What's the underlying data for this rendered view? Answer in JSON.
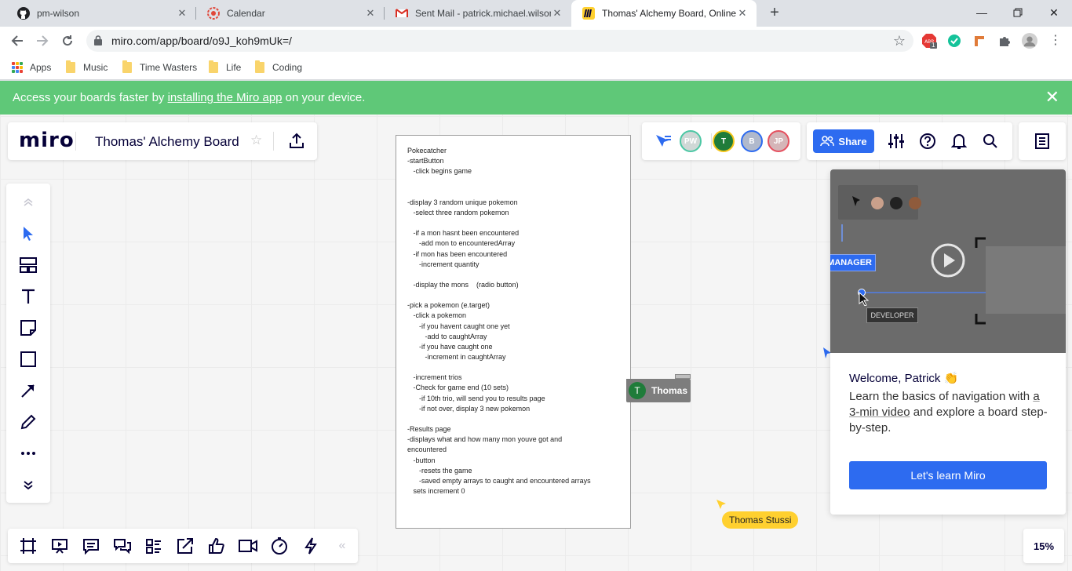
{
  "browser": {
    "tabs": [
      {
        "title": "pm-wilson",
        "icon": "github-icon"
      },
      {
        "title": "Calendar",
        "icon": "calendar-icon"
      },
      {
        "title": "Sent Mail - patrick.michael.wilson",
        "icon": "gmail-icon"
      },
      {
        "title": "Thomas' Alchemy Board, Online",
        "icon": "miro-icon"
      }
    ],
    "url": "miro.com/app/board/o9J_koh9mUk=/",
    "ext_badge": "1",
    "bookmarks": [
      {
        "label": "Apps"
      },
      {
        "label": "Music"
      },
      {
        "label": "Time Wasters"
      },
      {
        "label": "Life"
      },
      {
        "label": "Coding"
      }
    ]
  },
  "banner": {
    "prefix": "Access your boards faster by ",
    "link": "installing the Miro app",
    "suffix": " on your device."
  },
  "miro": {
    "logo": "miro",
    "board_name": "Thomas' Alchemy Board",
    "collaborators": [
      {
        "initials": "PW",
        "color": "#4cc7a4"
      },
      {
        "initials": "T",
        "color": "#1f7c3a"
      },
      {
        "initials": "B",
        "color": "#8ea4cf"
      },
      {
        "initials": "JP",
        "color": "#e58e96"
      }
    ],
    "share_label": "Share",
    "zoom": "15%",
    "collapse_label": "«"
  },
  "document": {
    "lines": [
      "Pokecatcher",
      "-startButton",
      "   -click begins game",
      "",
      "",
      "-display 3 random unique pokemon",
      "   -select three random pokemon",
      "",
      "   -if a mon hasnt been encountered",
      "      -add mon to encounteredArray",
      "   -if mon has been encountered",
      "      -increment quantity",
      "",
      "   -display the mons    (radio button)",
      "",
      "-pick a pokemon (e.target)",
      "   -click a pokemon",
      "      -if you havent caught one yet",
      "         -add to caughtArray",
      "      -if you have caught one",
      "         -increment in caughtArray",
      "",
      "   -increment trios",
      "   -Check for game end (10 sets)",
      "      -if 10th trio, will send you to results page",
      "      -if not over, display 3 new pokemon",
      "",
      "-Results page",
      "-displays what and how many mon youve got and",
      "encountered",
      "   -button",
      "      -resets the game",
      "      -saved empty arrays to caught and encountered arrays",
      "   sets increment 0"
    ]
  },
  "cursors": {
    "thomas": {
      "initial": "T",
      "name": "Thomas"
    },
    "stussi": {
      "name": "Thomas Stussi"
    }
  },
  "welcome": {
    "video_role_1": "MANAGER",
    "video_role_2": "DEVELOPER",
    "title": "Welcome, Patrick 👏",
    "text_1": "Learn the basics of navigation with",
    "text_link": "a 3-min video",
    "text_2": " and explore a board step-by-step.",
    "button": "Let's learn Miro"
  },
  "colors": {
    "banner": "#5fc878",
    "accent_blue": "#2d6bf0",
    "miro_dark": "#050038",
    "cursor_yellow": "#ffd02f"
  }
}
